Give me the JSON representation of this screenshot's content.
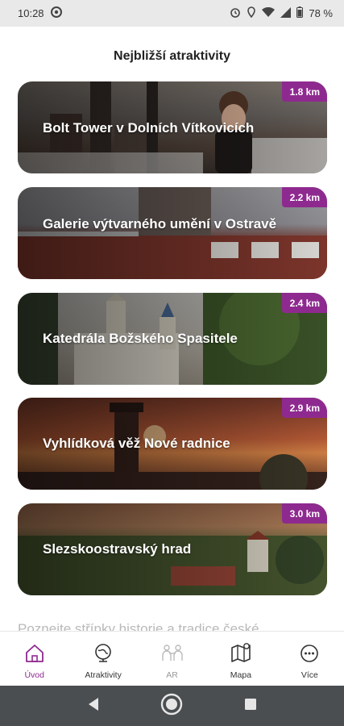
{
  "status_bar": {
    "time": "10:28",
    "battery": "78 %"
  },
  "page": {
    "title": "Nejbližší atraktivity"
  },
  "attractions": [
    {
      "title": "Bolt Tower v Dolních Vítkovicích",
      "distance": "1.8 km"
    },
    {
      "title": "Galerie výtvarného umění v Ostravě",
      "distance": "2.2 km"
    },
    {
      "title": "Katedrála Božského Spasitele",
      "distance": "2.4 km"
    },
    {
      "title": "Vyhlídková věž Nové radnice",
      "distance": "2.9 km"
    },
    {
      "title": "Slezskoostravský hrad",
      "distance": "3.0 km"
    }
  ],
  "teaser": "Poznejte střípky historie a tradice české",
  "bottom_nav": [
    {
      "label": "Úvod",
      "icon": "home-icon",
      "active": true
    },
    {
      "label": "Atraktivity",
      "icon": "globe-icon",
      "active": false
    },
    {
      "label": "AR",
      "icon": "ar-people-icon",
      "active": false
    },
    {
      "label": "Mapa",
      "icon": "map-icon",
      "active": false
    },
    {
      "label": "Více",
      "icon": "more-icon",
      "active": false
    }
  ],
  "colors": {
    "accent": "#8e2a8f",
    "status_bar_bg": "#e9e9ea",
    "system_nav_bg": "#4a4e51"
  }
}
